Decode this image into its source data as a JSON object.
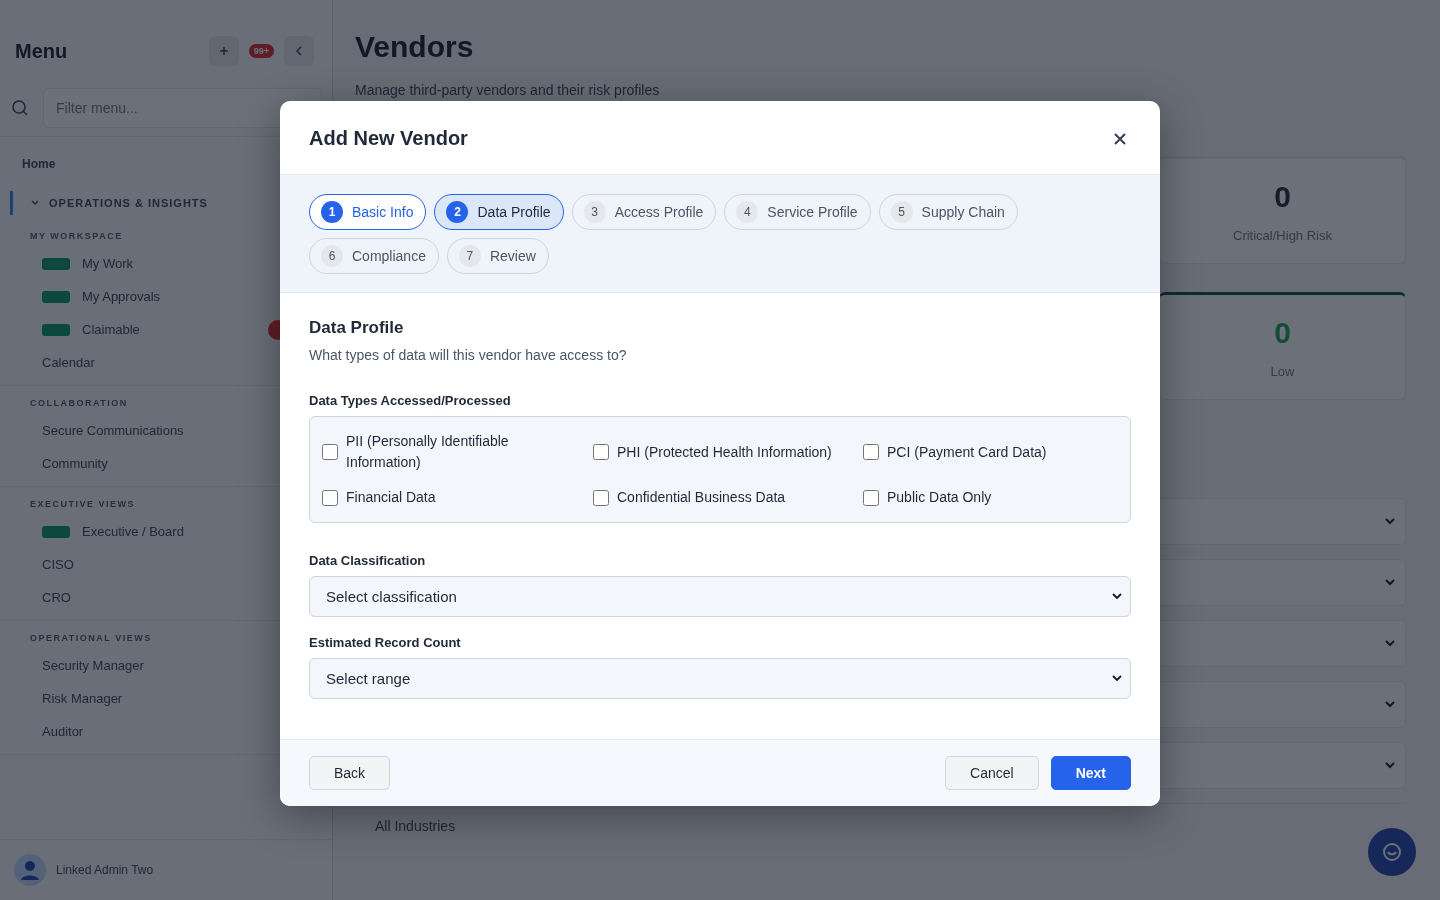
{
  "sidebar": {
    "title": "Menu",
    "notification_badge": "99+",
    "filter": {
      "placeholder": "Filter menu..."
    },
    "home": "Home",
    "section": {
      "label": "OPERATIONS & INSIGHTS",
      "expanded": true
    },
    "groups": [
      {
        "label": "MY WORKSPACE",
        "items": [
          {
            "label": "My Work",
            "new": true,
            "alert": false
          },
          {
            "label": "My Approvals",
            "new": true,
            "alert": false
          },
          {
            "label": "Claimable",
            "new": true,
            "alert": true
          },
          {
            "label": "Calendar",
            "new": false,
            "alert": false
          }
        ]
      },
      {
        "label": "COLLABORATION",
        "items": [
          {
            "label": "Secure Communications",
            "new": false,
            "alert": false
          },
          {
            "label": "Community",
            "new": false,
            "alert": false
          }
        ]
      },
      {
        "label": "EXECUTIVE VIEWS",
        "items": [
          {
            "label": "Executive / Board",
            "new": true,
            "alert": false
          },
          {
            "label": "CISO",
            "new": false,
            "alert": false
          },
          {
            "label": "CRO",
            "new": false,
            "alert": false
          }
        ]
      },
      {
        "label": "OPERATIONAL VIEWS",
        "items": [
          {
            "label": "Security Manager",
            "new": false,
            "alert": false
          },
          {
            "label": "Risk Manager",
            "new": false,
            "alert": false
          },
          {
            "label": "Auditor",
            "new": false,
            "alert": false
          }
        ]
      }
    ],
    "user": "Linked Admin Two"
  },
  "page": {
    "title": "Vendors",
    "subtitle": "Manage third-party vendors and their risk profiles",
    "stats": [
      {
        "value": "0",
        "label": "Critical/High Risk",
        "color": "#161e2d"
      },
      {
        "value": "0",
        "label": "Low",
        "color": "#134d34"
      }
    ],
    "industry_filter": "All Industries"
  },
  "modal": {
    "title": "Add New Vendor",
    "steps": [
      {
        "number": "1",
        "label": "Basic Info",
        "selected": false,
        "completed": true
      },
      {
        "number": "2",
        "label": "Data Profile",
        "selected": true,
        "completed": false
      },
      {
        "number": "3",
        "label": "Access Profile",
        "selected": false,
        "completed": false
      },
      {
        "number": "4",
        "label": "Service Profile",
        "selected": false,
        "completed": false
      },
      {
        "number": "5",
        "label": "Supply Chain",
        "selected": false,
        "completed": false
      },
      {
        "number": "6",
        "label": "Compliance",
        "selected": false,
        "completed": false
      },
      {
        "number": "7",
        "label": "Review",
        "selected": false,
        "completed": false
      }
    ],
    "section_title": "Data Profile",
    "section_description": "What types of data will this vendor have access to?",
    "data_types": {
      "label": "Data Types Accessed/Processed",
      "options": [
        {
          "label": "PII (Personally Identifiable Information)",
          "checked": false
        },
        {
          "label": "PHI (Protected Health Information)",
          "checked": false
        },
        {
          "label": "PCI (Payment Card Data)",
          "checked": false
        },
        {
          "label": "Financial Data",
          "checked": false
        },
        {
          "label": "Confidential Business Data",
          "checked": false
        },
        {
          "label": "Public Data Only",
          "checked": false
        }
      ]
    },
    "selects": [
      {
        "label": "Data Classification",
        "value": "Select classification"
      },
      {
        "label": "Estimated Record Count",
        "value": "Select range"
      }
    ],
    "buttons": {
      "back": "Back",
      "cancel": "Cancel",
      "next": "Next"
    }
  }
}
